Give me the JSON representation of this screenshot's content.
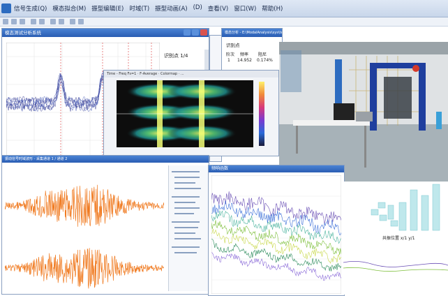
{
  "menu": {
    "items": [
      "信号生成(Q)",
      "模态拟合(M)",
      "振型编辑(E)",
      "时域(T)",
      "振型动画(A)",
      "(D)",
      "查看(V)",
      "窗口(W)",
      "帮助(H)"
    ]
  },
  "win_top": {
    "title": "模态测试分析系统",
    "info_label": "识别点 1/4"
  },
  "win_mode": {
    "title": "模态分析 - E:\\ModalAnalysis\\sys\\testdata",
    "sub_title": "识别点 ",
    "col1": "阶次",
    "col2": "频率",
    "col3": "阻尼",
    "row_idx": "1",
    "row_freq": "14.952",
    "row_damp": "0.174%"
  },
  "win_spectrogram": {
    "title": "Time - Freq   Fs=1  ·  F-Average  ·  Colormap  ·  ..."
  },
  "win_time": {
    "title": "振动信号时域波形 - 采集通道 1 / 通道 2"
  },
  "win_fft": {
    "title": "频响函数"
  },
  "panel_3d": {
    "label": "共振位置  x/1  y/1"
  },
  "colors": {
    "titlebar": "#2a5db3",
    "signal_orange": "#f07a20",
    "fft_purple": "#6a4fb5"
  }
}
